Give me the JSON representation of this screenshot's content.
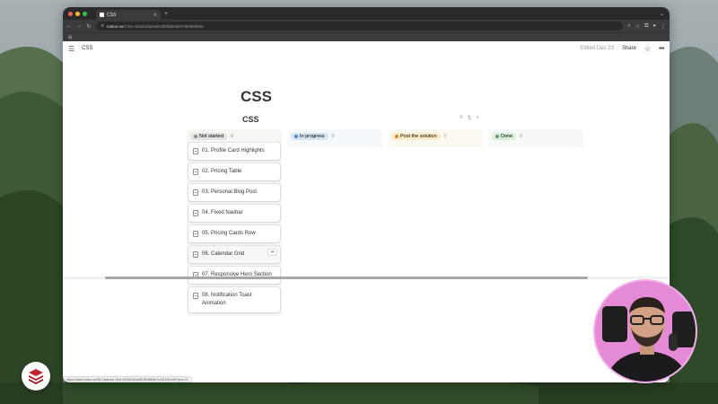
{
  "browser": {
    "tab_title": "CSS",
    "url_host": "notion.so",
    "url_path": "/CSS-2d34b2d2a4813f0d6b66bf7482869bbe",
    "status_url": "https://www.notion.so/06-Calendar-Grid-2d34b2d2a4813f0d6b6e7cc9143e1e5f?pvs=21"
  },
  "notion": {
    "breadcrumb": "CSS",
    "edited": "Edited Dec 23",
    "share_label": "Share",
    "page_title": "CSS",
    "database_title": "CSS"
  },
  "board": {
    "columns": [
      {
        "label": "Not started",
        "count": "8",
        "pill_bg": "#e3e2e0",
        "dot_color": "#91918e",
        "column_bg": "#f7f6f3",
        "cards": [
          "01. Profile Card Highlights",
          "02. Pricing Table",
          "03. Personal Blog Post",
          "04. Fixed Navbar",
          "05. Pricing Cards Row",
          "06. Calendar Grid",
          "07. Responsive Hero Section",
          "08. Notification Toast Animation"
        ]
      },
      {
        "label": "In progress",
        "count": "0",
        "pill_bg": "#d3e5ef",
        "dot_color": "#5e87c9",
        "column_bg": "#f5f9fc",
        "cards": []
      },
      {
        "label": "Post the solution",
        "count": "0",
        "pill_bg": "#fdecc8",
        "dot_color": "#cb912f",
        "column_bg": "#fcf9f2",
        "cards": []
      },
      {
        "label": "Done",
        "count": "0",
        "pill_bg": "#dbeddb",
        "dot_color": "#6c9b7d",
        "column_bg": "#f6f9f6",
        "cards": []
      }
    ]
  },
  "icons": {
    "menu": "hamburger-icon",
    "star": "star-icon",
    "more": "more-icon",
    "filter": "filter-icon",
    "sort": "sort-icon",
    "search": "search-icon",
    "page": "document-icon"
  }
}
